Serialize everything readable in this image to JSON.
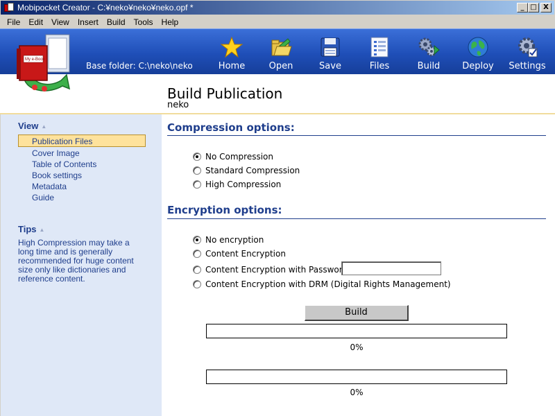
{
  "window": {
    "title": "Mobipocket Creator - C:¥neko¥neko¥neko.opf *",
    "minimize": "_",
    "maximize": "□",
    "close": "X"
  },
  "menu": [
    {
      "label": "File"
    },
    {
      "label": "Edit"
    },
    {
      "label": "View"
    },
    {
      "label": "Insert"
    },
    {
      "label": "Build"
    },
    {
      "label": "Tools"
    },
    {
      "label": "Help"
    }
  ],
  "header": {
    "base_folder": "Base folder: C:\\neko\\neko",
    "logo_text": "My e-Book",
    "toolbar": [
      {
        "label": "Home",
        "icon": "star-icon"
      },
      {
        "label": "Open",
        "icon": "folder-icon"
      },
      {
        "label": "Save",
        "icon": "floppy-icon"
      },
      {
        "label": "Files",
        "icon": "files-icon"
      },
      {
        "label": "Build",
        "icon": "gears-icon"
      },
      {
        "label": "Deploy",
        "icon": "globe-icon"
      },
      {
        "label": "Settings",
        "icon": "gear-check-icon"
      }
    ]
  },
  "page": {
    "title": "Build Publication",
    "subtitle": "neko"
  },
  "sidebar": {
    "view_heading": "View",
    "items": [
      {
        "label": "Publication Files",
        "active": true
      },
      {
        "label": "Cover Image"
      },
      {
        "label": "Table of Contents"
      },
      {
        "label": "Book settings"
      },
      {
        "label": "Metadata"
      },
      {
        "label": "Guide"
      }
    ],
    "tips_heading": "Tips",
    "tips_text": "High Compression may take a long time and is generally recommended for huge content size only like dictionaries and reference content."
  },
  "compression": {
    "title": "Compression options:",
    "options": [
      {
        "label": "No Compression",
        "checked": true
      },
      {
        "label": "Standard Compression",
        "checked": false
      },
      {
        "label": "High Compression",
        "checked": false
      }
    ]
  },
  "encryption": {
    "title": "Encryption options:",
    "options": [
      {
        "label": "No encryption",
        "checked": true
      },
      {
        "label": "Content Encryption",
        "checked": false
      },
      {
        "label": "Content Encryption with Password :",
        "checked": false
      },
      {
        "label": "Content Encryption with DRM (Digital Rights Management)",
        "checked": false
      }
    ],
    "password_value": ""
  },
  "build": {
    "button_label": "Build",
    "progress1": {
      "value": 0,
      "label": "0%"
    },
    "progress2": {
      "value": 0,
      "label": "0%"
    }
  },
  "colors": {
    "accent": "#1f3e8c",
    "header_blue": "#1f4fb8",
    "sidebar_bg": "#dfe8f7",
    "active_item": "#fee29c"
  }
}
